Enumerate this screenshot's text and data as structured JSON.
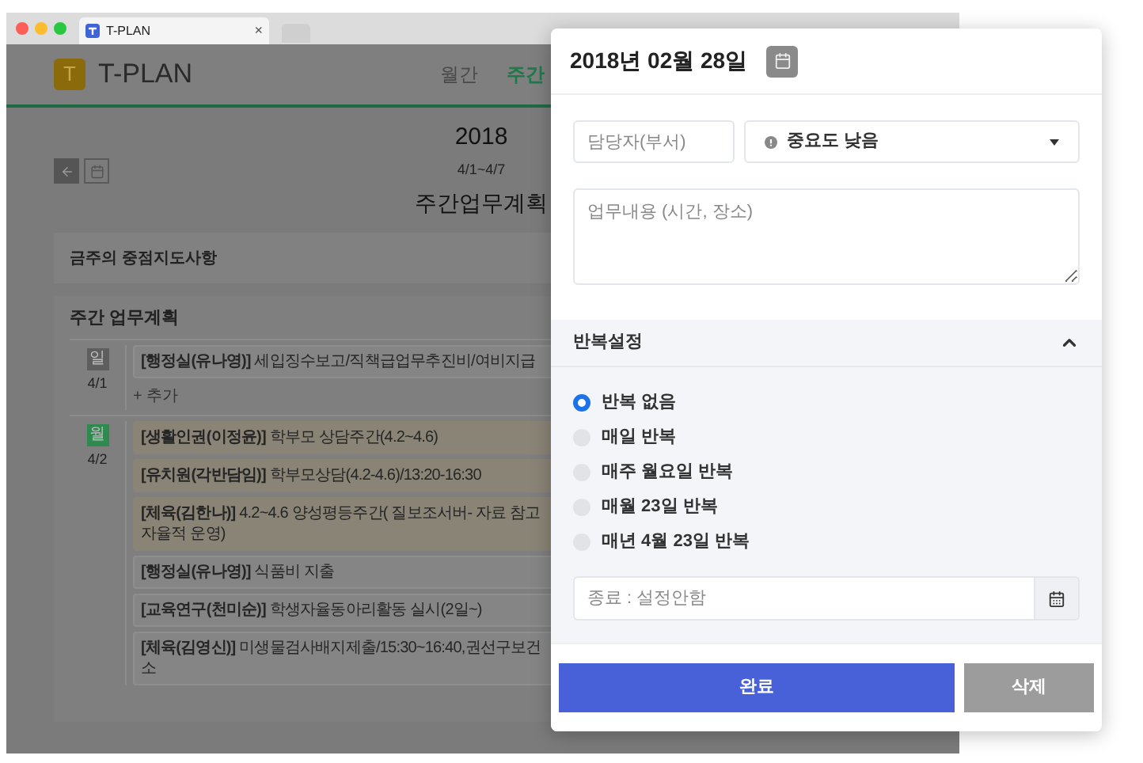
{
  "browser": {
    "tab": {
      "title": "T-PLAN",
      "close": "×"
    }
  },
  "app": {
    "logo": "T",
    "brand": "T-PLAN",
    "nav": [
      {
        "label": "월간",
        "selected": false
      },
      {
        "label": "주간",
        "selected": true
      }
    ]
  },
  "week": {
    "year": "2018",
    "range": "4/1~4/7",
    "title": "주간업무계획"
  },
  "focus_section": {
    "title": "금주의 중점지도사항"
  },
  "plan": {
    "title": "주간 업무계획",
    "days": [
      {
        "weekday": "일",
        "date": "4/1",
        "color": "#5e5e5e",
        "add": "+ 추가",
        "entries": [
          {
            "text": "**[행정실(유나영)]** 세입징수보고/직책급업무추진비/여비지급",
            "highlighted": false
          }
        ]
      },
      {
        "weekday": "월",
        "date": "4/2",
        "color": "#2f8a4f",
        "entries": [
          {
            "text": "**[생활인권(이정윤)]** 학부모 상담주간(4.2~4.6)",
            "highlighted": true
          },
          {
            "text": "**[유치원(각반담임)]** 학부모상담(4.2-4.6)/13:20-16:30",
            "highlighted": true
          },
          {
            "text": "**[체육(김한나)]** 4.2~4.6 양성평등주간( 질보조서버- 자료 참고 자율적 운영)",
            "highlighted": true
          },
          {
            "text": "**[행정실(유나영)]** 식품비 지출",
            "highlighted": false
          },
          {
            "text": "**[교육연구(천미순)]** 학생자율동아리활동 실시(2일~)",
            "highlighted": false
          },
          {
            "text": "**[체육(김영신)]** 미생물검사배지제출/15:30~16:40,권선구보건소",
            "highlighted": false
          }
        ]
      }
    ]
  },
  "dialog": {
    "date": "2018년 02월 28일",
    "assignee": {
      "placeholder": "담당자(부서)"
    },
    "priority": {
      "value": "중요도 낮음"
    },
    "content": {
      "placeholder": "업무내용 (시간, 장소)"
    },
    "repeat": {
      "title": "반복설정",
      "expanded": true,
      "options": [
        {
          "label": "반복 없음",
          "selected": true
        },
        {
          "label": "매일 반복",
          "selected": false
        },
        {
          "label": "매주 월요일 반복",
          "selected": false
        },
        {
          "label": "매월 23일 반복",
          "selected": false
        },
        {
          "label": "매년 4월 23일 반복",
          "selected": false
        }
      ]
    },
    "end_date": {
      "placeholder": "종료 : 설정안함"
    },
    "buttons": [
      {
        "label": "완료",
        "kind": "primary"
      },
      {
        "label": "삭제",
        "kind": "secondary"
      }
    ]
  }
}
